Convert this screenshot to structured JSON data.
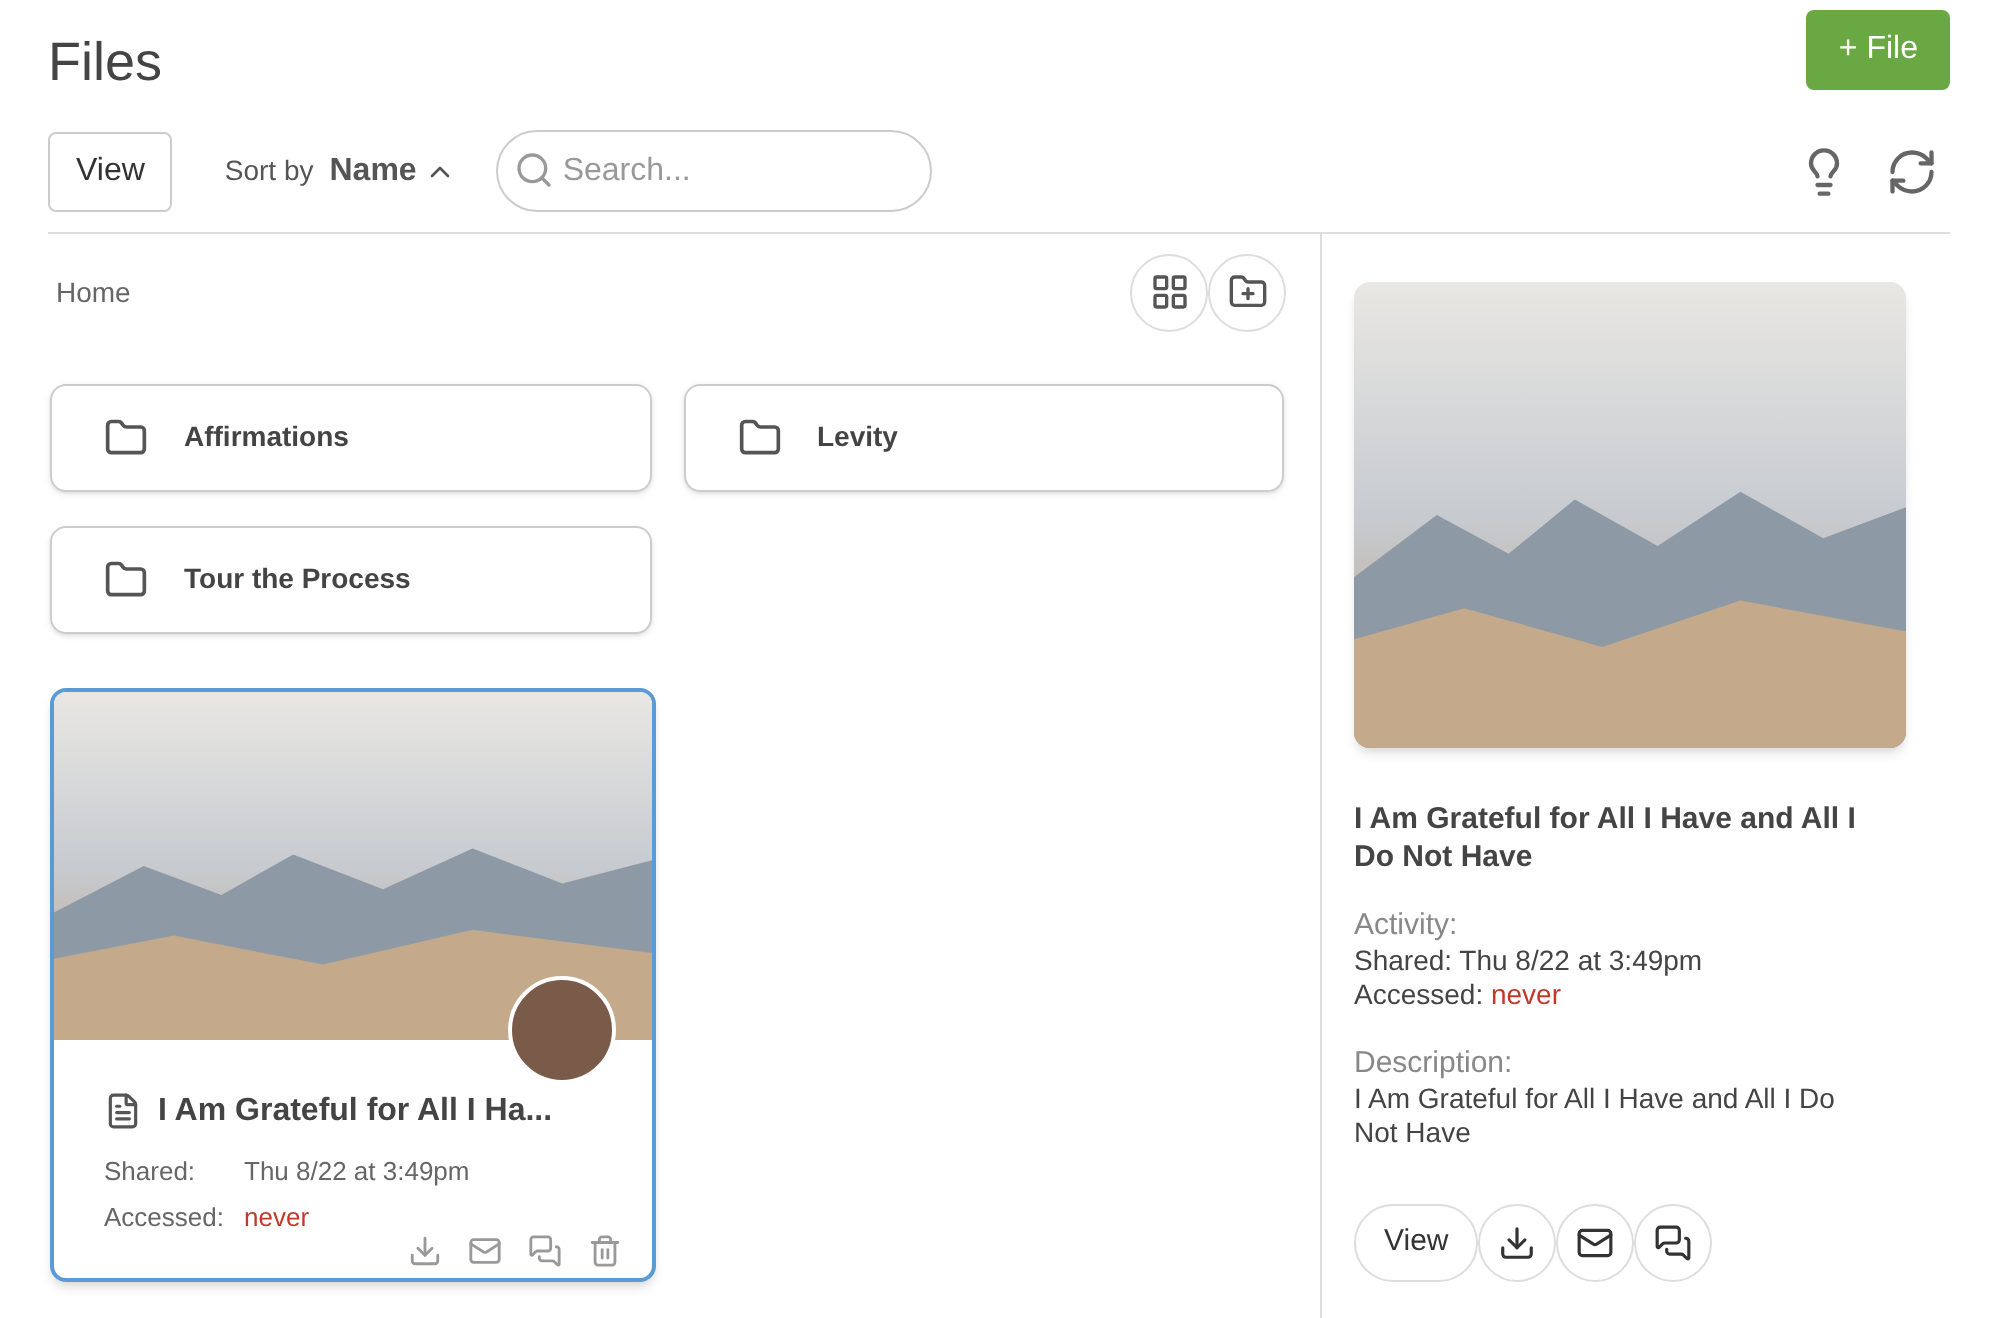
{
  "header": {
    "title": "Files",
    "new_button": "+ File"
  },
  "toolbar": {
    "view_button": "View",
    "sort_label": "Sort by",
    "sort_field": "Name",
    "search": {
      "placeholder": "Search..."
    }
  },
  "breadcrumb": "Home",
  "folders": [
    {
      "name": "Affirmations"
    },
    {
      "name": "Levity"
    },
    {
      "name": "Tour the Process"
    }
  ],
  "files": [
    {
      "title": "I Am Grateful for All I Ha...",
      "shared_label": "Shared:",
      "shared": "Thu 8/22 at 3:49pm",
      "accessed_label": "Accessed:",
      "accessed": "never",
      "selected": true
    }
  ],
  "details": {
    "title": "I Am Grateful for All I Have and All I Do Not Have",
    "activity_label": "Activity:",
    "shared": "Shared: Thu 8/22 at 3:49pm",
    "accessed_label": "Accessed:",
    "accessed": "never",
    "description_label": "Description:",
    "description": "I Am Grateful for All I Have and All I Do Not Have",
    "view_button": "View"
  }
}
